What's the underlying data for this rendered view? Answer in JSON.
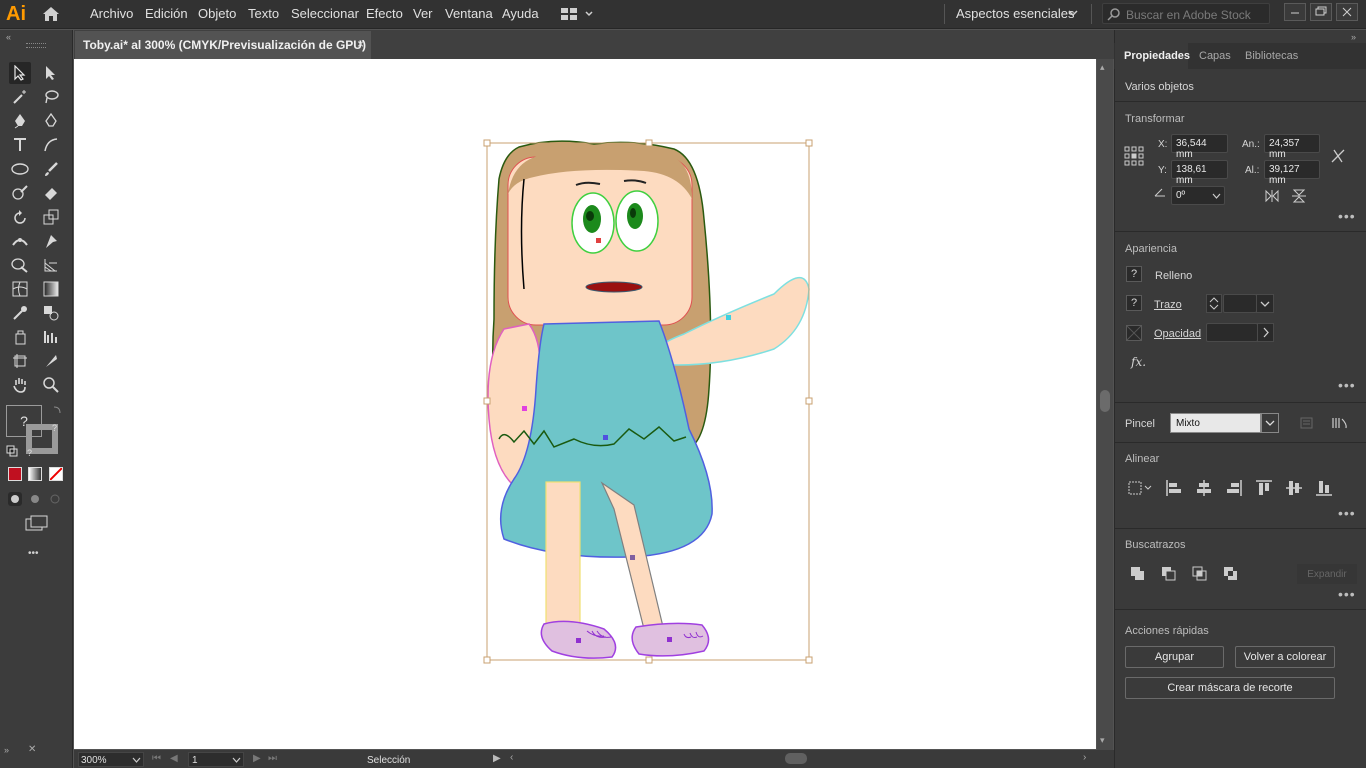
{
  "app": {
    "logo": "Ai",
    "workspace": "Aspectos esenciales",
    "search_placeholder": "Buscar en Adobe Stock"
  },
  "menu": [
    "Archivo",
    "Edición",
    "Objeto",
    "Texto",
    "Seleccionar",
    "Efecto",
    "Ver",
    "Ventana",
    "Ayuda"
  ],
  "document": {
    "tab_title": "Toby.ai* al 300% (CMYK/Previsualización de GPU)",
    "close": "×"
  },
  "status": {
    "zoom": "300%",
    "page": "1",
    "tool": "Selección"
  },
  "toolbar": {
    "fill_stroke_unknown": "?",
    "more": "•••"
  },
  "panel": {
    "tabs": [
      "Propiedades",
      "Capas",
      "Bibliotecas"
    ],
    "selection": "Varios objetos",
    "transform": {
      "title": "Transformar",
      "x_label": "X:",
      "x_value": "36,544 mm",
      "y_label": "Y:",
      "y_value": "138,61 mm",
      "w_label": "An.:",
      "w_value": "24,357 mm",
      "h_label": "Al.:",
      "h_value": "39,127 mm",
      "angle_value": "0º"
    },
    "appearance": {
      "title": "Apariencia",
      "fill_label": "Relleno",
      "stroke_label": "Trazo",
      "opacity_label": "Opacidad",
      "fx_label": "fx.",
      "unknown": "?"
    },
    "brush": {
      "label": "Pincel",
      "value": "Mixto"
    },
    "align": {
      "title": "Alinear"
    },
    "pathfinder": {
      "title": "Buscatrazos",
      "expand": "Expandir"
    },
    "quick_actions": {
      "title": "Acciones rápidas",
      "group": "Agrupar",
      "recolor": "Volver a colorear",
      "clip_mask": "Crear máscara de recorte"
    },
    "more": "•••"
  },
  "colors": {
    "accent": "#ff9a00",
    "artboard": "#ffffff",
    "selection_box": "#c8a070"
  }
}
